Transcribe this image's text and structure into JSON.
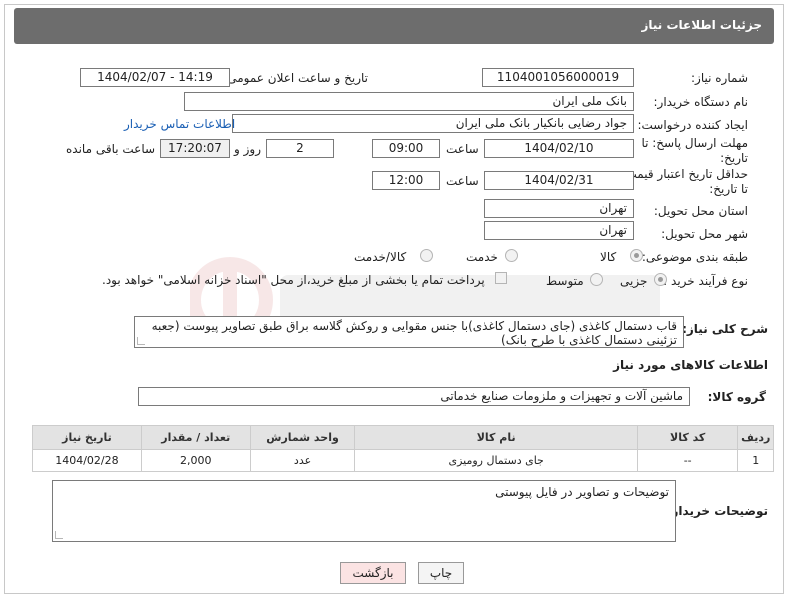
{
  "header": {
    "title": "جزئیات اطلاعات نیاز"
  },
  "fields": {
    "need_number_label": "شماره نیاز:",
    "need_number": "1104001056000019",
    "announce_label": "تاریخ و ساعت اعلان عمومی:",
    "announce_value": "1404/02/07 - 14:19",
    "buyer_org_label": "نام دستگاه خریدار:",
    "buyer_org": "بانک ملی ایران",
    "creator_label": "ایجاد کننده درخواست:",
    "creator": "جواد رضایی بانکیار بانک ملی ایران",
    "contact_link": "اطلاعات تماس خریدار",
    "deadline_label_1": "مهلت ارسال پاسخ: تا",
    "deadline_label_2": "تاریخ:",
    "deadline_date": "1404/02/10",
    "time_label": "ساعت",
    "deadline_time": "09:00",
    "days_value": "2",
    "days_label": "روز و",
    "remaining_time": "17:20:07",
    "remaining_label": "ساعت باقی مانده",
    "min_price_label_1": "حداقل تاریخ اعتبار قیمت:",
    "min_price_label_2": "تا تاریخ:",
    "min_price_date": "1404/02/31",
    "min_price_time": "12:00",
    "province_label": "استان محل تحویل:",
    "province": "تهران",
    "city_label": "شهر محل تحویل:",
    "city": "تهران",
    "category_label": "طبقه بندی موضوعی:",
    "category_options": [
      "کالا",
      "خدمت",
      "کالا/خدمت"
    ],
    "process_label": "نوع فرآیند خرید :",
    "process_options": [
      "جزیی",
      "متوسط"
    ],
    "payment_note": "پرداخت تمام یا بخشی از مبلغ خرید،از محل \"اسناد خزانه اسلامی\" خواهد بود."
  },
  "description": {
    "label": "شرح کلی نیاز:",
    "text": "قاب دستمال کاغذی (جای دستمال کاغذی)با جنس مقوایی و روکش گلاسه براق طبق تصاویر پیوست (جعبه تزئینی دستمال کاغذی با طرح بانک)"
  },
  "goods": {
    "section_title": "اطلاعات کالاهای مورد نیاز",
    "group_label": "گروه کالا:",
    "group_value": "ماشین آلات و تجهیزات و ملزومات صنایع خدماتی",
    "columns": [
      "ردیف",
      "کد کالا",
      "نام کالا",
      "واحد شمارش",
      "تعداد / مقدار",
      "تاریخ نیاز"
    ],
    "rows": [
      [
        "1",
        "--",
        "جای دستمال رومیزی",
        "عدد",
        "2,000",
        "1404/02/28"
      ]
    ]
  },
  "buyer_notes": {
    "label": "توضیحات خریدار:",
    "text": "توضیحات و تصاویر در فایل پیوستی"
  },
  "buttons": {
    "print": "چاپ",
    "back": "بازگشت"
  },
  "colors": {
    "titlebar": "#6d6d6d",
    "link": "#1a5fb4",
    "back_button": "#fbe3e3"
  }
}
